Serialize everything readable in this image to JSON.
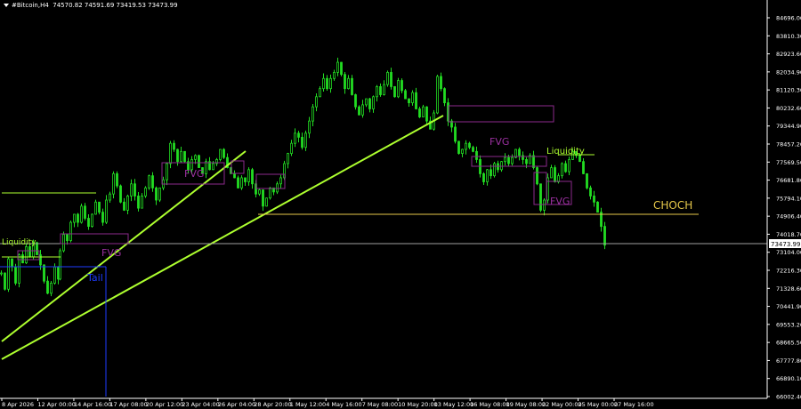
{
  "header": {
    "symbol": "#Bitcoin,H4",
    "ohlc": "74570.82 74591.69 73419.53 73473.99"
  },
  "colors": {
    "background": "#000000",
    "candle": "#22dd22",
    "axis": "#ffffff",
    "trendline": "#adff2f",
    "zone": "#8b2a8b",
    "choch": "#e6c84a",
    "blue": "#1e3cff",
    "price_line": "#a0a0a0"
  },
  "chart_data": {
    "type": "candlestick",
    "x_ticks": [
      "8 Apr 2026",
      "12 Apr 00:00",
      "14 Apr 16:00",
      "17 Apr 08:00",
      "20 Apr 12:00",
      "23 Apr 04:00",
      "26 Apr 04:00",
      "28 Apr 20:00",
      "1 May 12:00",
      "4 May 16:00",
      "7 May 08:00",
      "10 May 20:00",
      "13 May 12:00",
      "16 May 08:00",
      "19 May 08:00",
      "22 May 00:00",
      "25 May 00:00",
      "27 May 16:00"
    ],
    "y_ticks": [
      "84696.00",
      "83810.30",
      "82923.60",
      "82034.90",
      "81120.30",
      "80232.60",
      "79344.90",
      "78457.20",
      "77569.50",
      "76681.80",
      "75794.10",
      "74906.40",
      "74018.70",
      "73104.00",
      "72216.30",
      "71328.60",
      "70441.90",
      "69553.20",
      "68665.50",
      "67777.80",
      "66890.10",
      "66002.40"
    ],
    "ylim": [
      66002.4,
      85200
    ],
    "current_price": "73473.99",
    "close_path": [
      [
        0,
        72100
      ],
      [
        4,
        71300
      ],
      [
        8,
        72800
      ],
      [
        12,
        72400
      ],
      [
        16,
        71600
      ],
      [
        20,
        73000
      ],
      [
        24,
        72600
      ],
      [
        28,
        73400
      ],
      [
        32,
        72900
      ],
      [
        36,
        73600
      ],
      [
        40,
        73000
      ],
      [
        44,
        72500
      ],
      [
        48,
        71700
      ],
      [
        52,
        71100
      ],
      [
        56,
        71600
      ],
      [
        60,
        72400
      ],
      [
        64,
        71800
      ],
      [
        66,
        73200
      ],
      [
        70,
        74000
      ],
      [
        74,
        73700
      ],
      [
        78,
        74600
      ],
      [
        82,
        75000
      ],
      [
        86,
        74600
      ],
      [
        90,
        75400
      ],
      [
        94,
        74800
      ],
      [
        98,
        74400
      ],
      [
        102,
        75000
      ],
      [
        106,
        75600
      ],
      [
        110,
        75100
      ],
      [
        114,
        74600
      ],
      [
        118,
        75700
      ],
      [
        122,
        76000
      ],
      [
        126,
        77000
      ],
      [
        130,
        76400
      ],
      [
        134,
        75600
      ],
      [
        138,
        75200
      ],
      [
        142,
        75900
      ],
      [
        146,
        76500
      ],
      [
        150,
        75900
      ],
      [
        154,
        75300
      ],
      [
        158,
        75900
      ],
      [
        162,
        76300
      ],
      [
        166,
        76900
      ],
      [
        170,
        76300
      ],
      [
        174,
        75700
      ],
      [
        178,
        76300
      ],
      [
        182,
        76700
      ],
      [
        186,
        77500
      ],
      [
        190,
        78500
      ],
      [
        194,
        78200
      ],
      [
        198,
        77600
      ],
      [
        202,
        78100
      ],
      [
        206,
        77600
      ],
      [
        210,
        77200
      ],
      [
        214,
        77700
      ],
      [
        218,
        77900
      ],
      [
        222,
        77300
      ],
      [
        226,
        77000
      ],
      [
        230,
        77600
      ],
      [
        234,
        77200
      ],
      [
        238,
        77500
      ],
      [
        242,
        77700
      ],
      [
        246,
        78200
      ],
      [
        250,
        77800
      ],
      [
        254,
        77300
      ],
      [
        258,
        77000
      ],
      [
        262,
        76800
      ],
      [
        266,
        76300
      ],
      [
        270,
        76800
      ],
      [
        274,
        76600
      ],
      [
        278,
        77200
      ],
      [
        282,
        76500
      ],
      [
        286,
        76000
      ],
      [
        290,
        76200
      ],
      [
        294,
        75400
      ],
      [
        298,
        75800
      ],
      [
        302,
        76300
      ],
      [
        306,
        76100
      ],
      [
        310,
        76500
      ],
      [
        314,
        76800
      ],
      [
        318,
        77500
      ],
      [
        322,
        78000
      ],
      [
        326,
        78500
      ],
      [
        330,
        79000
      ],
      [
        334,
        78800
      ],
      [
        338,
        78300
      ],
      [
        342,
        79000
      ],
      [
        346,
        79600
      ],
      [
        350,
        80300
      ],
      [
        354,
        80800
      ],
      [
        358,
        81200
      ],
      [
        362,
        81700
      ],
      [
        366,
        81200
      ],
      [
        370,
        81700
      ],
      [
        374,
        82000
      ],
      [
        378,
        82500
      ],
      [
        382,
        81900
      ],
      [
        386,
        81200
      ],
      [
        390,
        81700
      ],
      [
        394,
        80900
      ],
      [
        398,
        80300
      ],
      [
        402,
        79900
      ],
      [
        406,
        80400
      ],
      [
        410,
        80700
      ],
      [
        414,
        80200
      ],
      [
        418,
        80800
      ],
      [
        422,
        81300
      ],
      [
        426,
        80900
      ],
      [
        430,
        81400
      ],
      [
        434,
        82000
      ],
      [
        438,
        81300
      ],
      [
        442,
        80800
      ],
      [
        446,
        81600
      ],
      [
        450,
        81100
      ],
      [
        454,
        80700
      ],
      [
        458,
        80500
      ],
      [
        462,
        81000
      ],
      [
        466,
        80200
      ],
      [
        470,
        79800
      ],
      [
        474,
        80300
      ],
      [
        478,
        79600
      ],
      [
        482,
        79200
      ],
      [
        486,
        80000
      ],
      [
        490,
        81800
      ],
      [
        494,
        81200
      ],
      [
        498,
        80500
      ],
      [
        502,
        79600
      ],
      [
        506,
        79300
      ],
      [
        510,
        78600
      ],
      [
        514,
        78000
      ],
      [
        518,
        78200
      ],
      [
        522,
        78500
      ],
      [
        526,
        78300
      ],
      [
        530,
        78100
      ],
      [
        534,
        77700
      ],
      [
        538,
        77000
      ],
      [
        542,
        76600
      ],
      [
        546,
        77200
      ],
      [
        550,
        76900
      ],
      [
        554,
        77500
      ],
      [
        558,
        77200
      ],
      [
        562,
        77600
      ],
      [
        566,
        77800
      ],
      [
        570,
        77500
      ],
      [
        574,
        77800
      ],
      [
        578,
        78200
      ],
      [
        582,
        77900
      ],
      [
        586,
        77700
      ],
      [
        590,
        77500
      ],
      [
        594,
        77900
      ],
      [
        598,
        77300
      ],
      [
        602,
        76500
      ],
      [
        606,
        75200
      ],
      [
        610,
        75700
      ],
      [
        614,
        76800
      ],
      [
        618,
        77300
      ],
      [
        622,
        76600
      ],
      [
        626,
        76900
      ],
      [
        630,
        77500
      ],
      [
        634,
        77100
      ],
      [
        638,
        77700
      ],
      [
        642,
        78100
      ],
      [
        646,
        77900
      ],
      [
        650,
        77600
      ],
      [
        654,
        77000
      ],
      [
        658,
        76300
      ],
      [
        662,
        75900
      ],
      [
        666,
        75600
      ],
      [
        670,
        75100
      ],
      [
        674,
        74400
      ],
      [
        678,
        73474
      ]
    ],
    "annotations": [
      "Liquidity",
      "FVG",
      "FVG",
      "FVG",
      "FVG",
      "Liquidity",
      "CHOCH",
      "FVG"
    ]
  }
}
